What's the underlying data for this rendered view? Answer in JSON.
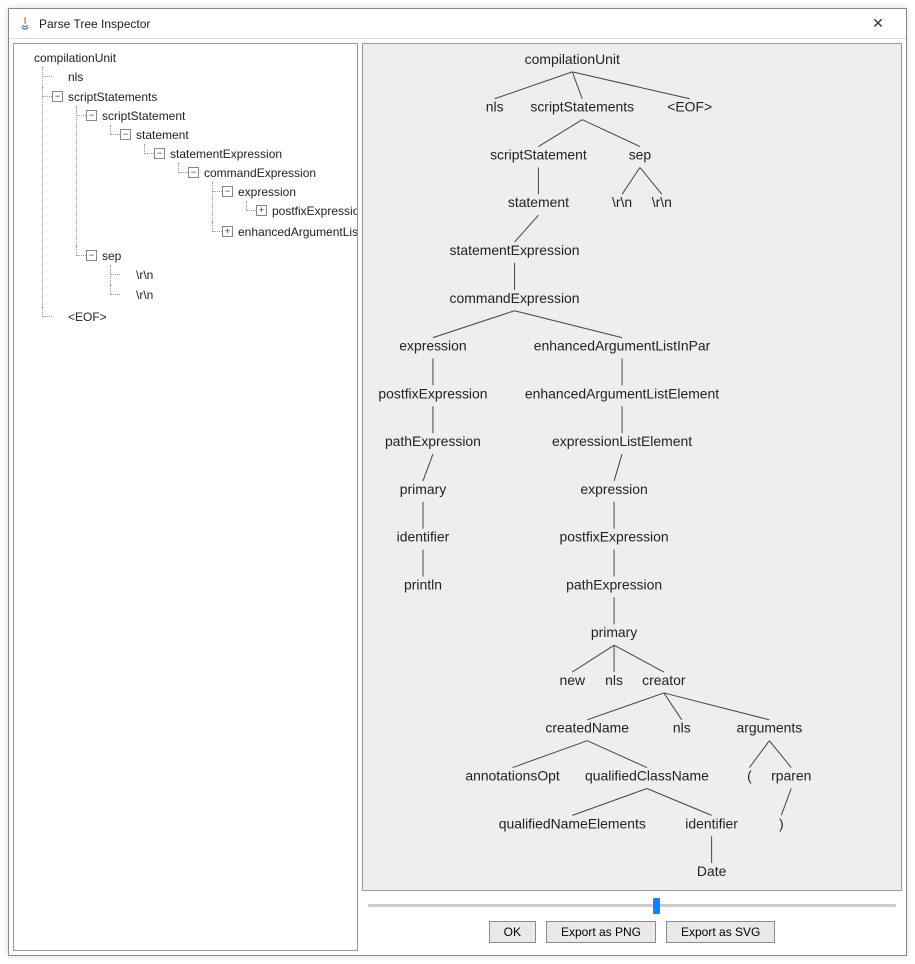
{
  "window": {
    "title": "Parse Tree Inspector"
  },
  "buttons": {
    "ok": "OK",
    "export_png": "Export as PNG",
    "export_svg": "Export as SVG"
  },
  "tree": {
    "n0": "compilationUnit",
    "n1": "nls",
    "n2": "scriptStatements",
    "n3": "scriptStatement",
    "n4": "statement",
    "n5": "statementExpression",
    "n6": "commandExpression",
    "n7": "expression",
    "n8": "postfixExpression",
    "n9": "enhancedArgumentListInPar",
    "n10": "sep",
    "n11": "\\r\\n",
    "n12": "\\r\\n",
    "n13": "<EOF>"
  },
  "diagram": {
    "compilationUnit": "compilationUnit",
    "nls": "nls",
    "scriptStatements": "scriptStatements",
    "eof": "<EOF>",
    "scriptStatement": "scriptStatement",
    "sep": "sep",
    "statement": "statement",
    "rn1": "\\r\\n",
    "rn2": "\\r\\n",
    "statementExpression": "statementExpression",
    "commandExpression": "commandExpression",
    "expression": "expression",
    "enhancedArgumentListInPar": "enhancedArgumentListInPar",
    "postfixExpression": "postfixExpression",
    "enhancedArgumentListElement": "enhancedArgumentListElement",
    "pathExpression": "pathExpression",
    "expressionListElement": "expressionListElement",
    "primary": "primary",
    "expression2": "expression",
    "identifier": "identifier",
    "postfixExpression2": "postfixExpression",
    "println": "println",
    "pathExpression2": "pathExpression",
    "primary2": "primary",
    "new": "new",
    "nls2": "nls",
    "creator": "creator",
    "createdName": "createdName",
    "nls3": "nls",
    "arguments": "arguments",
    "annotationsOpt": "annotationsOpt",
    "qualifiedClassName": "qualifiedClassName",
    "lparen": "(",
    "rparen_label": "rparen",
    "qualifiedNameElements": "qualifiedNameElements",
    "identifier2": "identifier",
    "rparen": ")",
    "date": "Date"
  }
}
